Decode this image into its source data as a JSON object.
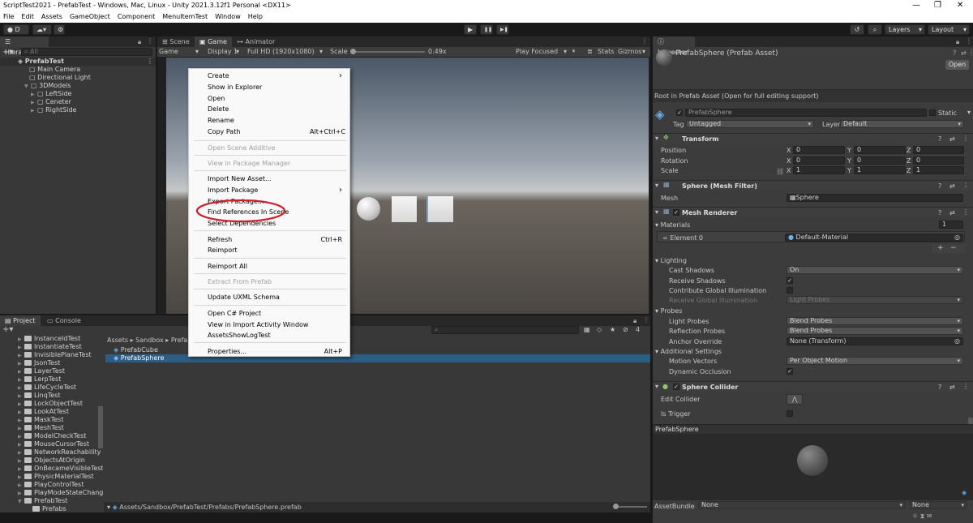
{
  "window": {
    "title": "ScriptTest2021 - PrefabTest - Windows, Mac, Linux - Unity 2021.3.12f1 Personal <DX11>",
    "minimize": "—",
    "maximize": "❐",
    "close": "✕"
  },
  "menu": [
    "File",
    "Edit",
    "Assets",
    "GameObject",
    "Component",
    "MenuItemTest",
    "Window",
    "Help"
  ],
  "toolbar": {
    "account": "D",
    "layers": "Layers",
    "layout": "Layout",
    "play": "▶",
    "pause": "❚❚",
    "step": "▶❚"
  },
  "hierarchy": {
    "tab": "Hierarchy",
    "search_placeholder": "All",
    "root": "PrefabTest",
    "items": [
      "Main Camera",
      "Directional Light",
      "3DModels",
      "LeftSide",
      "Ceneter",
      "RightSide"
    ]
  },
  "views": {
    "tabs": [
      "Scene",
      "Game",
      "Animator"
    ],
    "game_dropdown": "Game",
    "display": "Display 1",
    "resolution": "Full HD (1920x1080)",
    "scale_label": "Scale",
    "scale_value": "0.49x",
    "play_focused": "Play Focused",
    "stats": "Stats",
    "gizmos": "Gizmos"
  },
  "context_menu": {
    "items": [
      {
        "label": "Create",
        "sub": true
      },
      {
        "label": "Show in Explorer"
      },
      {
        "label": "Open"
      },
      {
        "label": "Delete"
      },
      {
        "label": "Rename"
      },
      {
        "label": "Copy Path",
        "key": "Alt+Ctrl+C"
      },
      {
        "label": "Open Scene Additive",
        "disabled": true
      },
      {
        "label": "View in Package Manager",
        "disabled": true
      },
      {
        "label": "Import New Asset..."
      },
      {
        "label": "Import Package",
        "sub": true
      },
      {
        "label": "Export Package..."
      },
      {
        "label": "Find References In Scene"
      },
      {
        "label": "Select Dependencies"
      },
      {
        "label": "Refresh",
        "key": "Ctrl+R"
      },
      {
        "label": "Reimport"
      },
      {
        "label": "Reimport All"
      },
      {
        "label": "Extract From Prefab",
        "disabled": true
      },
      {
        "label": "Update UXML Schema"
      },
      {
        "label": "Open C# Project"
      },
      {
        "label": "View in Import Activity Window"
      },
      {
        "label": "AssetsShowLogTest"
      },
      {
        "label": "Properties...",
        "key": "Alt+P"
      }
    ]
  },
  "project": {
    "tabs": [
      "Project",
      "Console"
    ],
    "folders": [
      "InstanceIdTest",
      "InstantiateTest",
      "InvisiblePlaneTest",
      "JsonTest",
      "LayerTest",
      "LerpTest",
      "LifeCycleTest",
      "LinqTest",
      "LockObjectTest",
      "LookAtTest",
      "MaskTest",
      "MeshTest",
      "ModelCheckTest",
      "MouseCursorTest",
      "NetworkReachability",
      "ObjectsAtOrigin",
      "OnBecameVisibleTest",
      "PhysicMaterialTest",
      "PlayControlTest",
      "PlayModeStateChange",
      "PrefabTest",
      "Prefabs"
    ],
    "breadcrumb": [
      "Assets",
      "Sandbox",
      "Prefab"
    ],
    "assets": [
      "PrefabCube",
      "PrefabSphere"
    ],
    "path": "Assets/Sandbox/PrefabTest/Prefabs/PrefabSphere.prefab",
    "count": "4"
  },
  "inspector": {
    "tab": "Inspector",
    "title": "PrefabSphere (Prefab Asset)",
    "open": "Open",
    "root_note": "Root in Prefab Asset (Open for full editing support)",
    "name": "PrefabSphere",
    "static": "Static",
    "tag_label": "Tag",
    "tag": "Untagged",
    "layer_label": "Layer",
    "layer": "Default",
    "transform": {
      "title": "Transform",
      "rows": [
        {
          "label": "Position",
          "x": "0",
          "y": "0",
          "z": "0"
        },
        {
          "label": "Rotation",
          "x": "0",
          "y": "0",
          "z": "0"
        },
        {
          "label": "Scale",
          "x": "1",
          "y": "1",
          "z": "1"
        }
      ]
    },
    "mesh_filter": {
      "title": "Sphere (Mesh Filter)",
      "label": "Mesh",
      "value": "Sphere"
    },
    "mesh_renderer": {
      "title": "Mesh Renderer",
      "materials": "Materials",
      "count": "1",
      "element": "Element 0",
      "material": "Default-Material",
      "plus": "+",
      "minus": "−",
      "lighting": "Lighting",
      "cast_shadows": "Cast Shadows",
      "cast_value": "On",
      "receive_shadows": "Receive Shadows",
      "contribute_gi": "Contribute Global Illumination",
      "receive_gi": "Receive Global Illumination",
      "receive_gi_value": "Light Probes",
      "probes": "Probes",
      "light_probes": "Light Probes",
      "light_value": "Blend Probes",
      "reflection_probes": "Reflection Probes",
      "reflection_value": "Blend Probes",
      "anchor": "Anchor Override",
      "anchor_value": "None (Transform)",
      "additional": "Additional Settings",
      "motion": "Motion Vectors",
      "motion_value": "Per Object Motion",
      "dynamic": "Dynamic Occlusion"
    },
    "sphere_collider": {
      "title": "Sphere Collider",
      "edit": "Edit Collider",
      "trigger": "Is Trigger"
    },
    "preview_title": "PrefabSphere",
    "assetbundle": "AssetBundle",
    "ab_value": "None",
    "ab_variant": "None"
  },
  "colors": {
    "accent": "#2c5d87",
    "selection": "#2c5d87",
    "highlight": "#cc1f2a"
  }
}
